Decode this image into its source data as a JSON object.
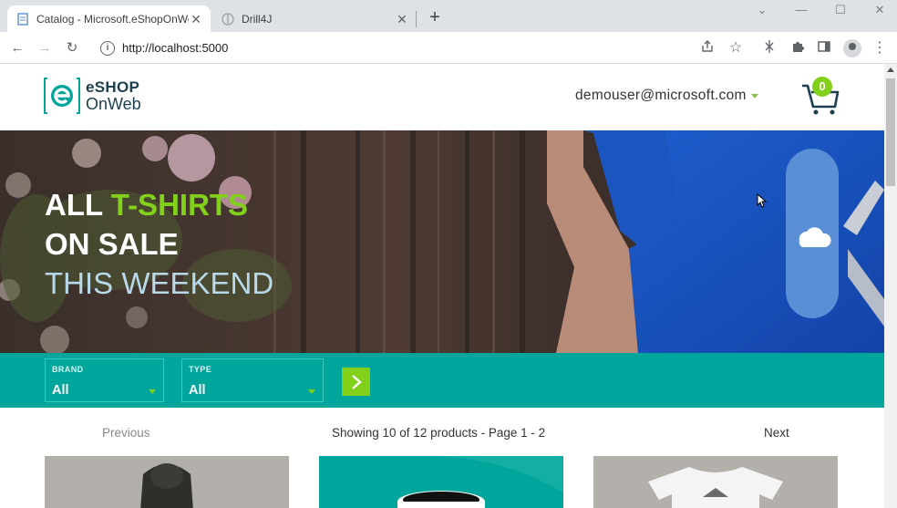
{
  "browser": {
    "tabs": [
      {
        "title": "Catalog - Microsoft.eShopOnWe",
        "icon": "page-icon",
        "active": true
      },
      {
        "title": "Drill4J",
        "icon": "drill-icon",
        "active": false
      }
    ],
    "url": "http://localhost:5000",
    "new_tab_symbol": "+"
  },
  "header": {
    "logo_line1": "eSHOP",
    "logo_line2": "OnWeb",
    "user_email": "demouser@microsoft.com",
    "cart_count": "0"
  },
  "banner": {
    "line1_white": "ALL ",
    "line1_green": "T-SHIRTS",
    "line2": "ON SALE",
    "line3": "THIS WEEKEND"
  },
  "filters": {
    "brand_label": "BRAND",
    "brand_value": "All",
    "type_label": "TYPE",
    "type_value": "All"
  },
  "pager": {
    "previous": "Previous",
    "info": "Showing 10 of 12 products - Page 1 - 2",
    "next": "Next"
  },
  "colors": {
    "brand_teal": "#00a69c",
    "brand_green": "#83d01b",
    "logo_dark": "#1c3f4f"
  }
}
